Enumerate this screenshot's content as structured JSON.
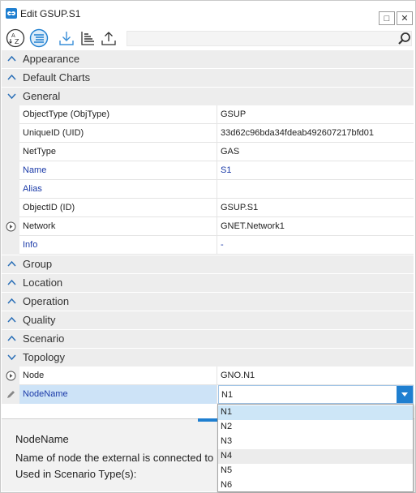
{
  "window": {
    "title": "Edit GSUP.S1",
    "maximize_glyph": "□",
    "close_glyph": "✕"
  },
  "toolbar": {
    "icons": [
      "sort-alphabetical-icon",
      "categorized-icon",
      "download-icon",
      "hierarchy-icon",
      "upload-icon"
    ],
    "search_placeholder": ""
  },
  "categories": {
    "appearance": "Appearance",
    "default_charts": "Default Charts",
    "general": "General",
    "group": "Group",
    "location": "Location",
    "operation": "Operation",
    "quality": "Quality",
    "scenario": "Scenario",
    "topology": "Topology"
  },
  "general_rows": [
    {
      "name": "ObjectType (ObjType)",
      "value": "GSUP"
    },
    {
      "name": "UniqueID (UID)",
      "value": "33d62c96bda34fdeab492607217bfd01"
    },
    {
      "name": "NetType",
      "value": "GAS"
    },
    {
      "name": "Name",
      "value": "S1"
    },
    {
      "name": "Alias",
      "value": ""
    },
    {
      "name": "ObjectID (ID)",
      "value": "GSUP.S1"
    },
    {
      "name": "Network",
      "value": "GNET.Network1"
    },
    {
      "name": "Info",
      "value": "-"
    }
  ],
  "topology_rows": [
    {
      "name": "Node",
      "value": "GNO.N1"
    },
    {
      "name": "NodeName",
      "value": "N1"
    }
  ],
  "dropdown_options": [
    "N1",
    "N2",
    "N3",
    "N4",
    "N5",
    "N6"
  ],
  "description": {
    "title": "NodeName",
    "text": "Name of node the external is connected to",
    "scenario_types": "Used in Scenario Type(s):"
  },
  "colors": {
    "accent": "#1f7fd0",
    "category_bg": "#ededed",
    "selection": "#cde3f7",
    "link_blue": "#1a3aa8"
  }
}
